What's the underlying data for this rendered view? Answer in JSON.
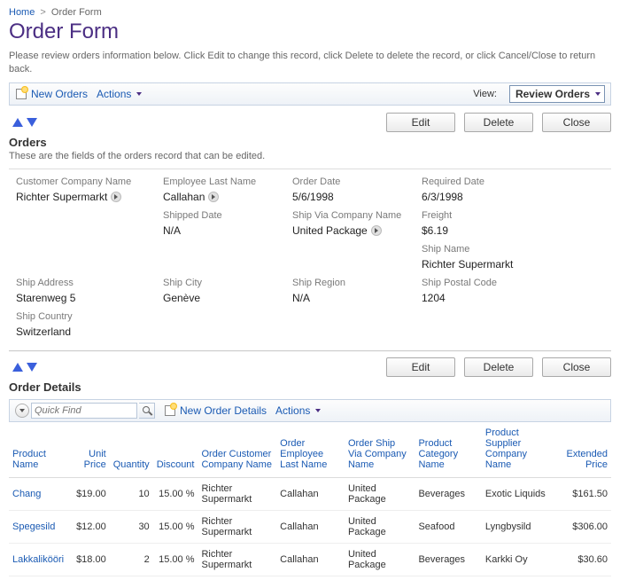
{
  "breadcrumb": {
    "home": "Home",
    "current": "Order Form",
    "sep": ">"
  },
  "page": {
    "title": "Order Form",
    "intro": "Please review orders information below. Click Edit to change this record, click Delete to delete the record, or click Cancel/Close to return back."
  },
  "toolbar": {
    "new_orders": "New Orders",
    "actions": "Actions",
    "view_label": "View:",
    "view_value": "Review Orders"
  },
  "buttons": {
    "edit": "Edit",
    "delete": "Delete",
    "close": "Close"
  },
  "orders_section": {
    "title": "Orders",
    "desc": "These are the fields of the orders record that can be edited."
  },
  "order": {
    "customer_company_name": {
      "label": "Customer Company Name",
      "value": "Richter Supermarkt",
      "lookup": true
    },
    "employee_last_name": {
      "label": "Employee Last Name",
      "value": "Callahan",
      "lookup": true
    },
    "order_date": {
      "label": "Order Date",
      "value": "5/6/1998"
    },
    "required_date": {
      "label": "Required Date",
      "value": "6/3/1998"
    },
    "shipped_date": {
      "label": "Shipped Date",
      "value": "N/A"
    },
    "ship_via_company_name": {
      "label": "Ship Via Company Name",
      "value": "United Package",
      "lookup": true
    },
    "freight": {
      "label": "Freight",
      "value": "$6.19"
    },
    "ship_name": {
      "label": "Ship Name",
      "value": "Richter Supermarkt"
    },
    "ship_address": {
      "label": "Ship Address",
      "value": "Starenweg 5"
    },
    "ship_city": {
      "label": "Ship City",
      "value": "Genève"
    },
    "ship_region": {
      "label": "Ship Region",
      "value": "N/A"
    },
    "ship_postal_code": {
      "label": "Ship Postal Code",
      "value": "1204"
    },
    "ship_country": {
      "label": "Ship Country",
      "value": "Switzerland"
    }
  },
  "details_section": {
    "title": "Order Details"
  },
  "details_toolbar": {
    "quick_find_placeholder": "Quick Find",
    "new_order_details": "New Order Details",
    "actions": "Actions"
  },
  "details_columns": {
    "product_name": "Product Name",
    "unit_price": "Unit Price",
    "quantity": "Quantity",
    "discount": "Discount",
    "order_customer_company_name": "Order Customer Company Name",
    "order_employee_last_name": "Order Employee Last Name",
    "order_ship_via_company_name": "Order Ship Via Company Name",
    "product_category_name": "Product Category Name",
    "product_supplier_company_name": "Product Supplier Company Name",
    "extended_price": "Extended Price"
  },
  "details_rows": [
    {
      "product_name": "Chang",
      "unit_price": "$19.00",
      "quantity": "10",
      "discount": "15.00 %",
      "order_customer_company_name": "Richter Supermarkt",
      "order_employee_last_name": "Callahan",
      "order_ship_via_company_name": "United Package",
      "product_category_name": "Beverages",
      "product_supplier_company_name": "Exotic Liquids",
      "extended_price": "$161.50"
    },
    {
      "product_name": "Spegesild",
      "unit_price": "$12.00",
      "quantity": "30",
      "discount": "15.00 %",
      "order_customer_company_name": "Richter Supermarkt",
      "order_employee_last_name": "Callahan",
      "order_ship_via_company_name": "United Package",
      "product_category_name": "Seafood",
      "product_supplier_company_name": "Lyngbysild",
      "extended_price": "$306.00"
    },
    {
      "product_name": "Lakkalikööri",
      "unit_price": "$18.00",
      "quantity": "2",
      "discount": "15.00 %",
      "order_customer_company_name": "Richter Supermarkt",
      "order_employee_last_name": "Callahan",
      "order_ship_via_company_name": "United Package",
      "product_category_name": "Beverages",
      "product_supplier_company_name": "Karkki Oy",
      "extended_price": "$30.60"
    }
  ]
}
